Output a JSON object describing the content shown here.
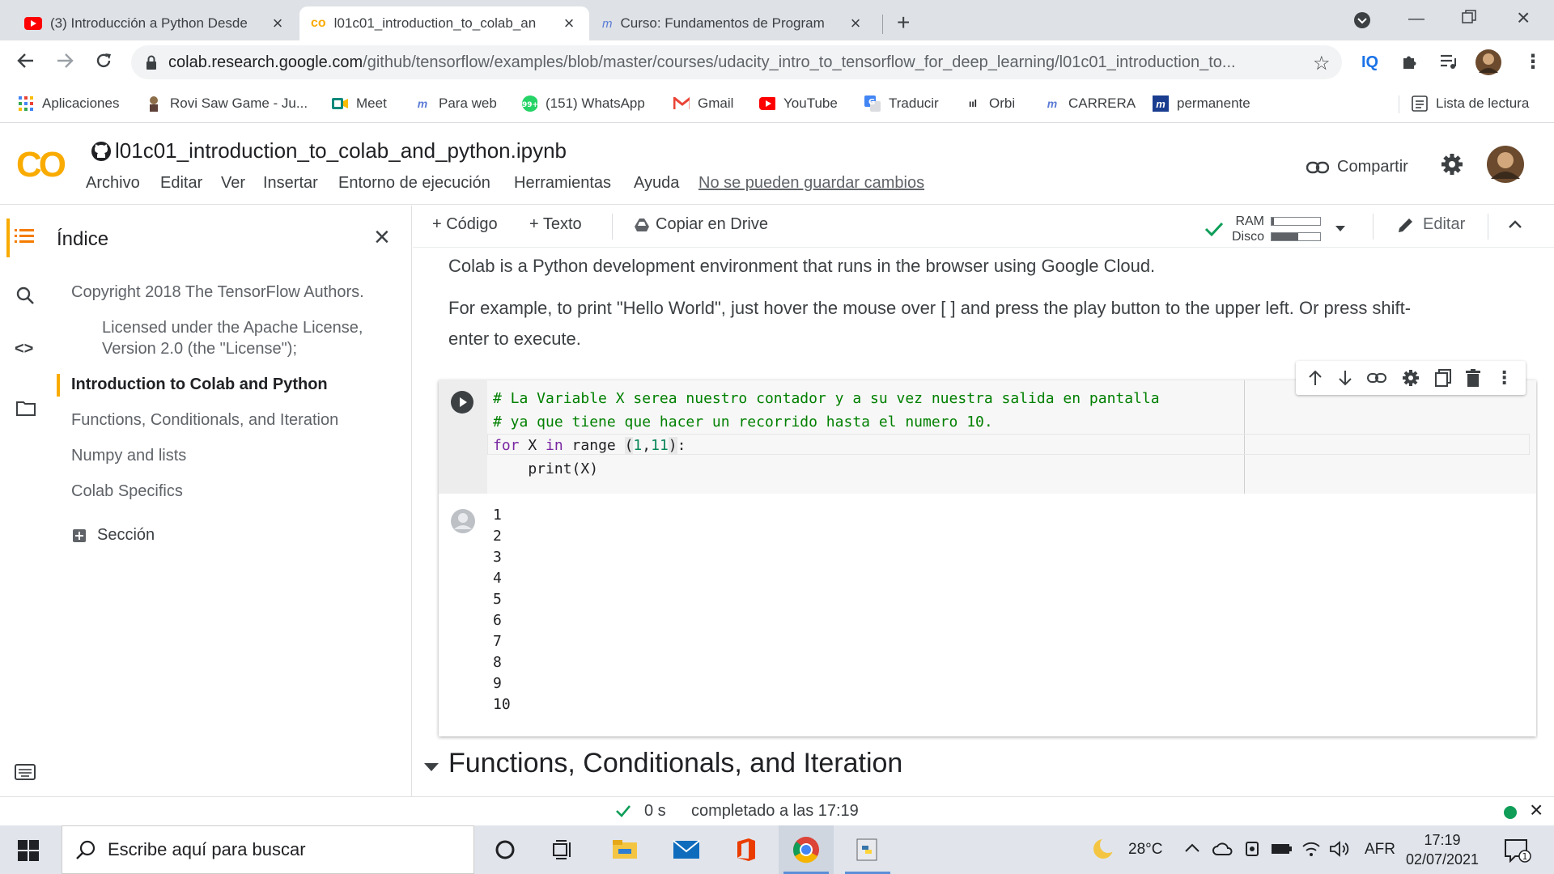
{
  "browser": {
    "tabs": [
      {
        "title": "(3) Introducción a Python Desde",
        "icon": "youtube-icon",
        "active": false
      },
      {
        "title": "l01c01_introduction_to_colab_an",
        "icon": "colab-icon",
        "active": true
      },
      {
        "title": "Curso: Fundamentos de Program",
        "icon": "platzi-icon",
        "active": false
      }
    ],
    "new_tab_label": "+",
    "url_host": "colab.research.google.com",
    "url_path": "/github/tensorflow/examples/blob/master/courses/udacity_intro_to_tensorflow_for_deep_learning/l01c01_introduction_to...",
    "extension_iq": "IQ",
    "bookmarks": [
      {
        "label": "Aplicaciones",
        "icon": "apps-grid-icon"
      },
      {
        "label": "Rovi Saw Game - Ju...",
        "icon": "rovi-icon"
      },
      {
        "label": "Meet",
        "icon": "meet-icon"
      },
      {
        "label": "Para web",
        "icon": "platzi-icon"
      },
      {
        "label": "(151) WhatsApp",
        "icon": "whatsapp-icon"
      },
      {
        "label": "Gmail",
        "icon": "gmail-icon"
      },
      {
        "label": "YouTube",
        "icon": "youtube-icon"
      },
      {
        "label": "Traducir",
        "icon": "translate-icon"
      },
      {
        "label": "Orbi",
        "icon": "orbi-icon"
      },
      {
        "label": "CARRERA",
        "icon": "platzi-icon"
      },
      {
        "label": "permanente",
        "icon": "platzi-icon"
      }
    ],
    "whatsapp_badge": "99+",
    "reading_list": "Lista de lectura"
  },
  "colab": {
    "logo_text": "CO",
    "notebook_title": "l01c01_introduction_to_colab_and_python.ipynb",
    "menu": [
      "Archivo",
      "Editar",
      "Ver",
      "Insertar",
      "Entorno de ejecución",
      "Herramientas",
      "Ayuda"
    ],
    "cannot_save": "No se pueden guardar cambios",
    "share_label": "Compartir",
    "toolbar": {
      "add_code": "+ Código",
      "add_text": "+ Texto",
      "copy_drive": "Copiar en Drive",
      "ram_label": "RAM",
      "disk_label": "Disco",
      "ram_usage": 0.05,
      "disk_usage": 0.55,
      "edit_label": "Editar"
    },
    "sidebar": {
      "title": "Índice",
      "items": [
        {
          "label": "Copyright 2018 The TensorFlow Authors.",
          "level": 1,
          "active": false
        },
        {
          "label": "Licensed under the Apache License, Version 2.0 (the \"License\");",
          "level": 2,
          "active": false
        },
        {
          "label": "Introduction to Colab and Python",
          "level": 1,
          "active": true
        },
        {
          "label": "Functions, Conditionals, and Iteration",
          "level": 1,
          "active": false
        },
        {
          "label": "Numpy and lists",
          "level": 1,
          "active": false
        },
        {
          "label": "Colab Specifics",
          "level": 1,
          "active": false
        }
      ],
      "add_section": "Sección"
    },
    "content": {
      "para1": "Colab is a Python development environment that runs in the browser using Google Cloud.",
      "para2_line1": "For example, to print \"Hello World\", just hover the mouse over [ ] and press the play button to the upper left. Or press shift-",
      "para2_line2": "enter to execute.",
      "code_lines": [
        "# La Variable X serea nuestro contador y a su vez nuestra salida en pantalla",
        "# ya que tiene que hacer un recorrido hasta el numero 10.",
        "for X in range (1,11):",
        "    print(X)"
      ],
      "output": [
        "1",
        "2",
        "3",
        "4",
        "5",
        "6",
        "7",
        "8",
        "9",
        "10"
      ],
      "next_heading": "Functions, Conditionals, and Iteration"
    },
    "status": {
      "duration": "0 s",
      "completed": "completado a las 17:19"
    }
  },
  "taskbar": {
    "search_placeholder": "Escribe aquí para buscar",
    "weather": "28°C",
    "language": "AFR",
    "time": "17:19",
    "date": "02/07/2021",
    "notification_count": "1"
  },
  "colors": {
    "colab_orange": "#f9ab00",
    "tab_bg": "#dee1e6",
    "accent_green": "#0f9d58"
  }
}
